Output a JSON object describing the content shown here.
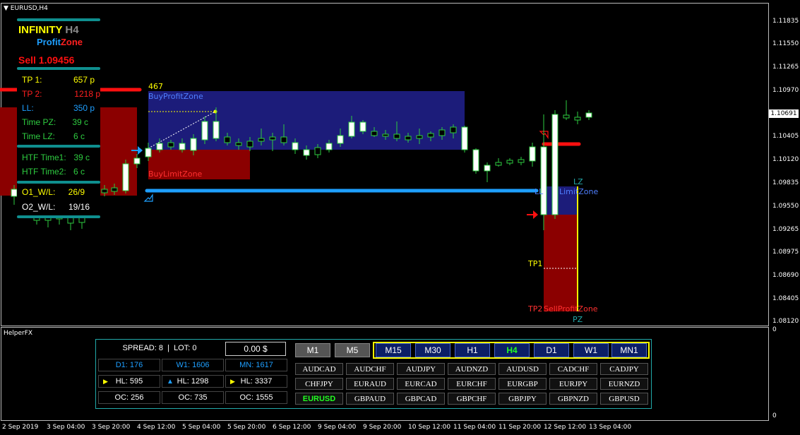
{
  "window": {
    "title": "EURUSD,H4",
    "subwindow_title": "HelperFX"
  },
  "colors": {
    "buy_zone": "#1c1c7a",
    "sell_zone": "#8b0000",
    "teal": "#0f8f8f",
    "blue_line": "#1e9fff",
    "red_line": "#ff1010"
  },
  "price_axis": [
    "1.11835",
    "1.11550",
    "1.11265",
    "1.10970",
    "1.10691",
    "1.10405",
    "1.10120",
    "1.09835",
    "1.09550",
    "1.09265",
    "1.08975",
    "1.08690",
    "1.08405",
    "1.08120"
  ],
  "current_price": "1.10691",
  "sub_axis": [
    "0",
    "0"
  ],
  "time_axis": [
    "2 Sep 2019",
    "3 Sep 04:00",
    "3 Sep 20:00",
    "4 Sep 12:00",
    "5 Sep 04:00",
    "5 Sep 20:00",
    "6 Sep 12:00",
    "9 Sep 04:00",
    "9 Sep 20:00",
    "10 Sep 12:00",
    "11 Sep 04:00",
    "11 Sep 20:00",
    "12 Sep 12:00",
    "13 Sep 04:00"
  ],
  "logo": {
    "word1": "INFINITY",
    "word2": "H4",
    "word3": "Profit",
    "word4": "Zone"
  },
  "signal": "Sell 1.09456",
  "info": {
    "tp1_label": "TP 1:",
    "tp1_value": "657 p",
    "tp2_label": "TP 2:",
    "tp2_value": "1218 p",
    "ll_label": "LL:",
    "ll_value": "350 p",
    "tpz_label": "Time PZ:",
    "tpz_value": "39 c",
    "tlz_label": "Time LZ:",
    "tlz_value": "6 c",
    "htf1_label": "HTF Time1:",
    "htf1_value": "39 c",
    "htf2_label": "HTF Time2:",
    "htf2_value": "6 c",
    "o1_label": "O1_W/L:",
    "o1_value": "26/9",
    "o2_label": "O2_W/L:",
    "o2_value": "19/16"
  },
  "zones": {
    "count": "467",
    "buy_profit": "BuyProfitZone",
    "buy_limit": "BuyLimitZone",
    "sell_limit_prefix": "LL",
    "sell_limit": "LimitZone",
    "sell_limit_tag": "LZ",
    "sell_profit_prefix": "TP2",
    "sell_profit": "SellProfitZone",
    "sell_profit_tag": "PZ",
    "tp1": "TP1"
  },
  "helper": {
    "spread": "SPREAD: 8  |  LOT: 0",
    "pl": "0.00 $",
    "d1": "D1: 176",
    "w1": "W1: 1606",
    "mn": "MN: 1617",
    "hl1": "HL: 595",
    "hl2": "HL: 1298",
    "hl3": "HL: 3337",
    "oc1": "OC: 256",
    "oc2": "OC: 735",
    "oc3": "OC: 1555",
    "timeframes": [
      "M1",
      "M5",
      "M15",
      "M30",
      "H1",
      "H4",
      "D1",
      "W1",
      "MN1"
    ],
    "active_timeframe": "H4",
    "symbols": [
      [
        "AUDCAD",
        "AUDCHF",
        "AUDJPY",
        "AUDNZD",
        "AUDUSD",
        "CADCHF",
        "CADJPY"
      ],
      [
        "CHFJPY",
        "EURAUD",
        "EURCAD",
        "EURCHF",
        "EURGBP",
        "EURJPY",
        "EURNZD"
      ],
      [
        "EURUSD",
        "GBPAUD",
        "GBPCAD",
        "GBPCHF",
        "GBPJPY",
        "GBPNZD",
        "GBPUSD"
      ]
    ],
    "active_symbol": "EURUSD"
  }
}
